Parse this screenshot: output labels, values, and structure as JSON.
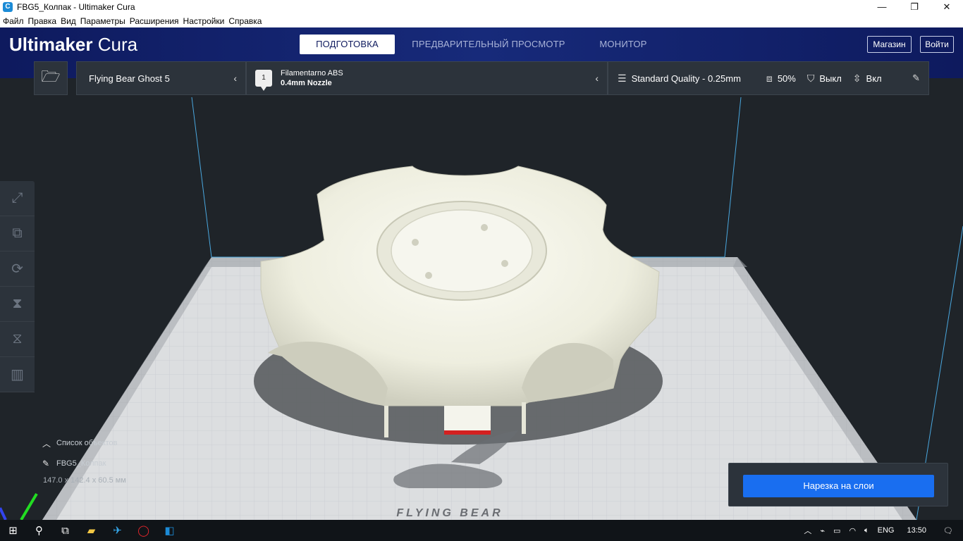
{
  "window": {
    "title": "FBG5_Колпак - Ultimaker Cura",
    "app_icon": "cura-icon"
  },
  "menu": [
    "Файл",
    "Правка",
    "Вид",
    "Параметры",
    "Расширения",
    "Настройки",
    "Справка"
  ],
  "header": {
    "logo_bold": "Ultimaker",
    "logo_light": "Cura",
    "tabs": [
      {
        "label": "ПОДГОТОВКА",
        "active": true
      },
      {
        "label": "ПРЕДВАРИТЕЛЬНЫЙ ПРОСМОТР",
        "active": false
      },
      {
        "label": "МОНИТОР",
        "active": false
      }
    ],
    "store_label": "Магазин",
    "login_label": "Войти",
    "bg_color": "#12206a"
  },
  "printer": {
    "name": "Flying Bear Ghost 5"
  },
  "material": {
    "extruder_number": "1",
    "name": "Filamentarno ABS",
    "nozzle": "0.4mm Nozzle"
  },
  "print_setup": {
    "profile": "Standard Quality - 0.25mm",
    "infill": "50%",
    "support": "Выкл",
    "adhesion": "Вкл"
  },
  "tools": [
    "move-icon",
    "scale-icon",
    "rotate-icon",
    "mirror-icon",
    "per-model-settings-icon",
    "support-blocker-icon"
  ],
  "object_list": {
    "toggle_label": "Список объектов",
    "object_name": "FBG5_Колпак",
    "dimensions": "147.0 x 142.4 x 60.5 мм"
  },
  "plate_logo_text": "FLYING BEAR",
  "slice": {
    "button_label": "Нарезка на слои",
    "accent": "#196ef0"
  },
  "taskbar": {
    "language": "ENG",
    "time": "13:50"
  }
}
